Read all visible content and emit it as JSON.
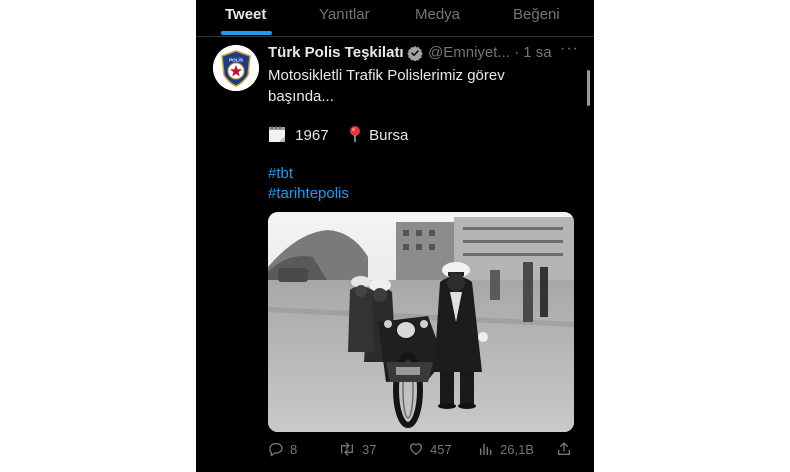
{
  "tabs": [
    {
      "label": "Tweet",
      "active": true
    },
    {
      "label": "Yanıtlar",
      "active": false
    },
    {
      "label": "Medya",
      "active": false
    },
    {
      "label": "Beğeni",
      "active": false
    }
  ],
  "tweet": {
    "author": {
      "display_name": "Türk Polis Teşkilatı",
      "handle": "@Emniyet...",
      "verified": true,
      "avatar_text": "POLİS"
    },
    "time": "· 1 sa",
    "text_lines": [
      "Motosikletli Trafik Polislerimiz görev",
      "başında..."
    ],
    "year_icon": "calendar-icon",
    "year": "1967",
    "location_icon": "pin-icon",
    "location": "Bursa",
    "hashtags": [
      "#tbt",
      "#tarihtepolis"
    ],
    "stats": {
      "replies": "8",
      "retweets": "37",
      "likes": "457",
      "views": "26,1B"
    }
  },
  "colors": {
    "background": "#000000",
    "text": "#e7e9ea",
    "muted": "#71767b",
    "accent": "#1d9bf0"
  }
}
